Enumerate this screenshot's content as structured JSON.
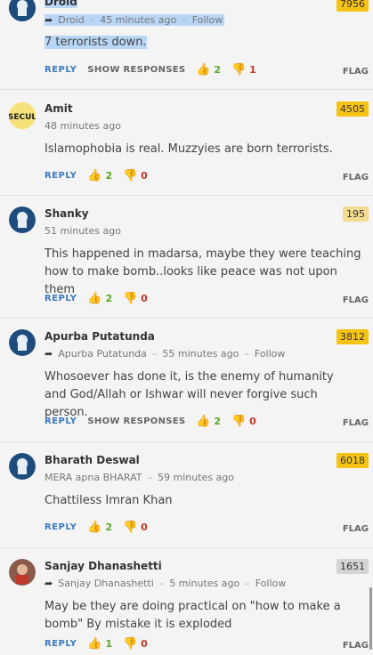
{
  "labels": {
    "reply": "REPLY",
    "show_responses": "SHOW RESPONSES",
    "flag": "FLAG",
    "follow": "Follow",
    "sep": "–"
  },
  "colors": {
    "score_gold": "#f4c316",
    "score_light": "#f1dc92",
    "score_grey": "#d4d4d4",
    "upvote": "#5aa629",
    "downvote": "#c0392b",
    "link": "#3b7bbf"
  },
  "comments": [
    {
      "name": "Droid",
      "score": "7956",
      "reply_to": "Droid",
      "time": "45 minutes ago",
      "follow": true,
      "text": "7 terrorists down.",
      "up": "2",
      "down": "1",
      "show_responses": true
    },
    {
      "name": "Amit",
      "score": "4505",
      "time": "48 minutes ago",
      "text": "Islamophobia is real. Muzzyies are born terrorists.",
      "up": "2",
      "down": "0"
    },
    {
      "name": "Shanky",
      "score": "195",
      "time": "51 minutes ago",
      "text": "This happened in madarsa, maybe they were teaching how to make bomb..looks like peace was not upon them",
      "up": "2",
      "down": "0"
    },
    {
      "name": "Apurba Putatunda",
      "score": "3812",
      "reply_to": "Apurba Putatunda",
      "time": "55 minutes ago",
      "follow": true,
      "text": "Whosoever has done it, is the enemy of humanity and God/Allah or Ishwar will never forgive such person.",
      "up": "2",
      "down": "0",
      "show_responses": true
    },
    {
      "name": "Bharath Deswal",
      "score": "6018",
      "location": "MERA apna BHARAT",
      "time": "59 minutes ago",
      "text": "Chattiless Imran Khan",
      "up": "2",
      "down": "0"
    },
    {
      "name": "Sanjay Dhanashetti",
      "score": "1651",
      "reply_to": "Sanjay Dhanashetti",
      "time": "5 minutes ago",
      "follow": true,
      "text": "May be they are doing practical on \"how to make a bomb\" By mistake it is exploded",
      "up": "1",
      "down": "0"
    }
  ]
}
